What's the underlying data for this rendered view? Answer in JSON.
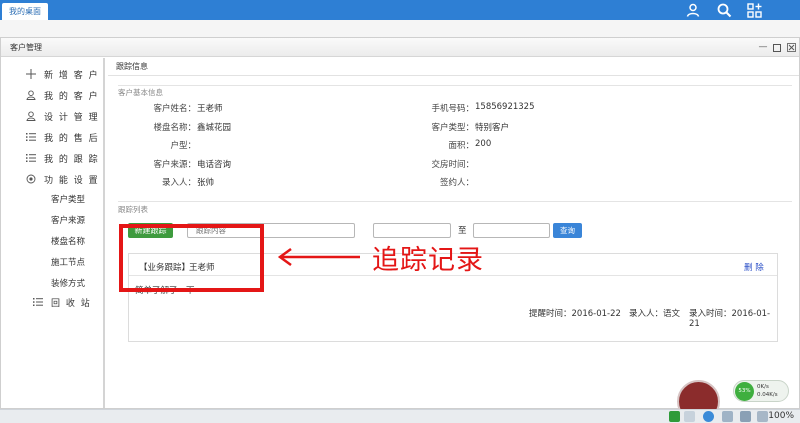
{
  "topbar": {
    "tab_label": "我的桌面",
    "icons": [
      "user-icon",
      "search-icon",
      "apps-icon"
    ]
  },
  "window": {
    "title": "客户管理"
  },
  "sidebar": {
    "items": [
      {
        "icon": "plus-icon",
        "label": "新 增 客 户"
      },
      {
        "icon": "user-icon",
        "label": "我 的 客 户"
      },
      {
        "icon": "user-icon",
        "label": "设 计 管 理"
      },
      {
        "icon": "list-icon",
        "label": "我 的 售 后"
      },
      {
        "icon": "list-icon",
        "label": "我 的 跟 踪"
      },
      {
        "icon": "gear-icon",
        "label": "功 能 设 置"
      }
    ],
    "subitems": [
      "客户类型",
      "客户来源",
      "楼盘名称",
      "施工节点",
      "装修方式"
    ],
    "recycle": {
      "icon": "list-icon",
      "label": "回 收 站"
    }
  },
  "content": {
    "header": "跟踪信息",
    "basic_section": "客户基本信息",
    "fields_left": [
      {
        "label": "客户姓名：",
        "value": "王老师"
      },
      {
        "label": "楼盘名称：",
        "value": "鑫城花园"
      },
      {
        "label": "户型：",
        "value": ""
      },
      {
        "label": "客户来源：",
        "value": "电话咨询"
      },
      {
        "label": "录入人：",
        "value": "张帅"
      }
    ],
    "fields_right": [
      {
        "label": "手机号码：",
        "value": "15856921325"
      },
      {
        "label": "客户类型：",
        "value": "特别客户"
      },
      {
        "label": "面积：",
        "value": "200"
      },
      {
        "label": "交房时间：",
        "value": ""
      },
      {
        "label": "签约人：",
        "value": ""
      }
    ],
    "list_section": "跟踪列表",
    "new_button": "新建跟踪",
    "search_placeholder": "跟踪内容",
    "date_separator": "至",
    "query_button": "查询",
    "record": {
      "tag": "【业务跟踪】",
      "name": "王老师",
      "delete": "删 除",
      "content": "简单了解了一下",
      "remind": "提醒时间：2016-01-22",
      "entry_person": "录入人：语文",
      "entry_time": "录入时间：2016-01-21"
    },
    "annotation": "追踪记录"
  },
  "taskbar": {
    "zoom": "100%",
    "net_percent": "53%",
    "net_up": "0K/s",
    "net_down": "0.04K/s"
  },
  "colors": {
    "topbar": "#2e7fd4",
    "annotation": "#e41616",
    "new_button": "#3e9b3e",
    "query_button": "#3a85d8"
  }
}
